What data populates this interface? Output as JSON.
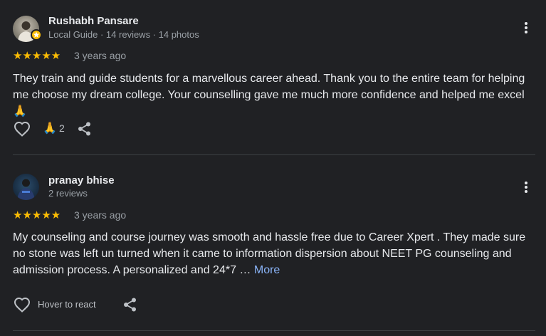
{
  "reviews": [
    {
      "name": "Rushabh Pansare",
      "meta": "Local Guide · 14 reviews · 14 photos",
      "stars": "★★★★★",
      "rating": 5,
      "time": "3 years ago",
      "text": "They train and guide students for a marvellous career ahead. Thank you to the entire team for helping me choose my dream college. Your counselling gave me much more confidence and helped me excel 🙏",
      "reaction_emoji": "🙏",
      "reaction_count": "2"
    },
    {
      "name": "pranay bhise",
      "meta": "2 reviews",
      "stars": "★★★★★",
      "rating": 5,
      "time": "3 years ago",
      "text": "My counseling and course journey was smooth and hassle free due to Career Xpert . They made sure no stone was left un turned when it came to information dispersion about NEET PG counseling and admission process. A personalized and 24*7 …",
      "more_label": "More",
      "hover_label": "Hover to react"
    }
  ],
  "colors": {
    "background": "#202124",
    "star": "#fbbc04",
    "link": "#8ab4f8"
  },
  "icons": [
    "heart-icon",
    "share-icon",
    "more-vert-icon",
    "local-guide-badge-icon"
  ]
}
